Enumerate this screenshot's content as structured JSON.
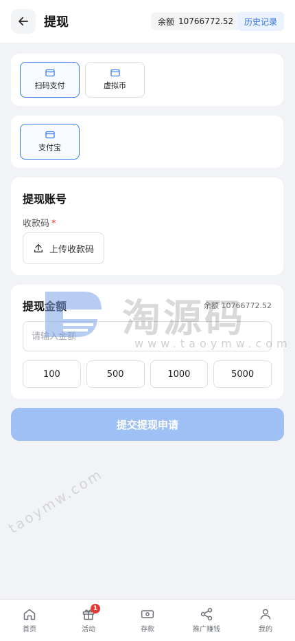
{
  "header": {
    "title": "提现",
    "balance_label": "余额",
    "balance_value": "10766772.52",
    "history_label": "历史记录"
  },
  "methods_row1": [
    {
      "label": "扫码支付",
      "icon": "card-icon",
      "selected": true
    },
    {
      "label": "虚拟币",
      "icon": "card-icon",
      "selected": false
    }
  ],
  "methods_row2": [
    {
      "label": "支付宝",
      "icon": "card-icon",
      "selected": true
    }
  ],
  "account": {
    "title": "提现账号",
    "field_label": "收款码",
    "required_mark": "*",
    "upload_label": "上传收款码"
  },
  "amount": {
    "title": "提现金额",
    "balance_text": "余额 10766772.52",
    "placeholder": "请输入金额",
    "quick_amounts": [
      "100",
      "500",
      "1000",
      "5000"
    ]
  },
  "submit_label": "提交提现申请",
  "watermark": {
    "brand": "淘源码",
    "url": "www.taoymw.com",
    "diagonal": "taoymw.com"
  },
  "nav": [
    {
      "label": "首页",
      "icon": "home-icon"
    },
    {
      "label": "活动",
      "icon": "gift-icon",
      "badge": "1"
    },
    {
      "label": "存款",
      "icon": "cash-icon"
    },
    {
      "label": "推广赚钱",
      "icon": "share-icon"
    },
    {
      "label": "我的",
      "icon": "user-icon"
    }
  ],
  "colors": {
    "accent": "#3b7ded",
    "submit_disabled": "#9ec0f5",
    "badge": "#e53935",
    "background": "#f2f3f7"
  }
}
